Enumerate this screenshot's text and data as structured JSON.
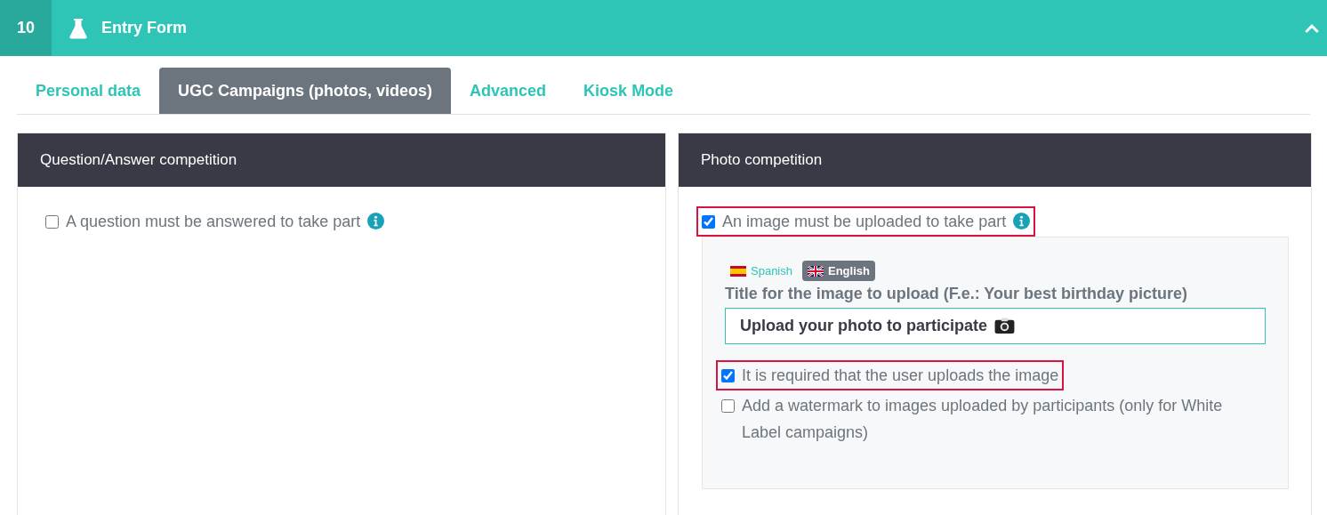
{
  "header": {
    "number": "10",
    "title": "Entry Form",
    "expanded": true
  },
  "tabs": [
    {
      "label": "Personal data",
      "selected": false
    },
    {
      "label": "UGC Campaigns (photos, videos)",
      "selected": true
    },
    {
      "label": "Advanced",
      "selected": false
    },
    {
      "label": "Kiosk Mode",
      "selected": false
    }
  ],
  "panels": [
    {
      "title": "Question/Answer competition",
      "options": [
        {
          "label": "A question must be answered to take part",
          "checked": false,
          "highlighted": false,
          "info": true
        }
      ]
    },
    {
      "title": "Photo competition",
      "options": [
        {
          "label": "An image must be uploaded to take part",
          "checked": true,
          "highlighted": true,
          "info": true
        }
      ],
      "details": {
        "languages": [
          {
            "label": "Spanish",
            "kind": "es",
            "selected": false
          },
          {
            "label": "English",
            "kind": "gb",
            "selected": true
          }
        ],
        "field_label": "Title for the image to upload (F.e.: Your best birthday picture)",
        "field_value": "Upload your photo to participate",
        "options": [
          {
            "label": "It is required that the user uploads the image",
            "checked": true,
            "highlighted": true,
            "info": false
          },
          {
            "label": "Add a watermark to images uploaded by participants (only for White Label campaigns)",
            "checked": false,
            "highlighted": false,
            "info": false
          }
        ]
      }
    }
  ]
}
